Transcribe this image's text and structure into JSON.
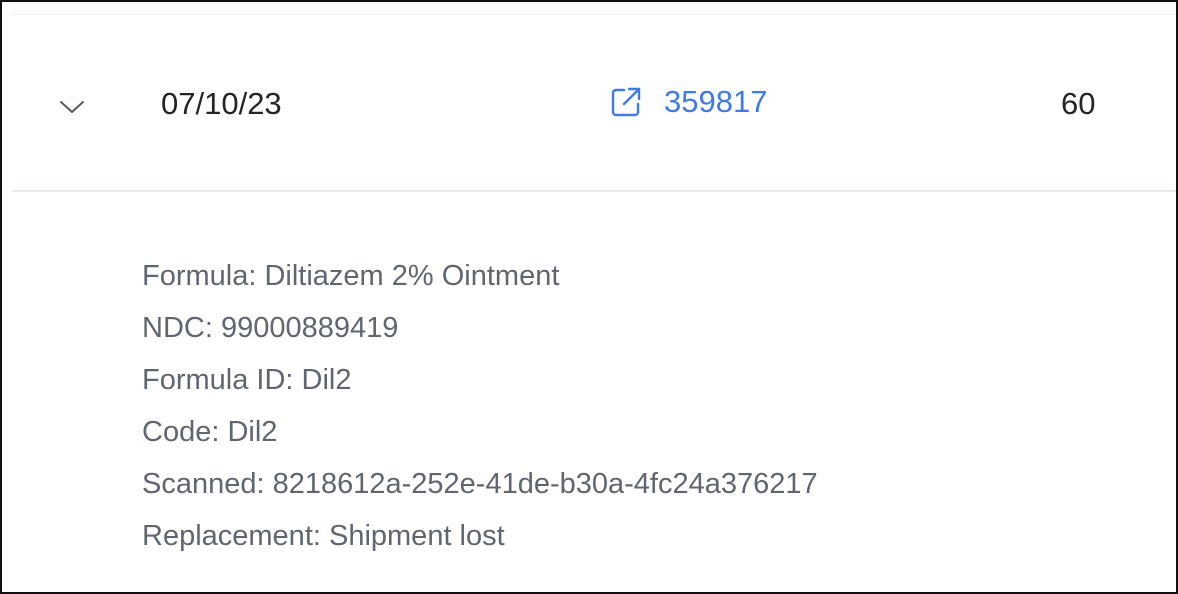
{
  "row": {
    "date": "07/10/23",
    "order_number": "359817",
    "quantity": "60",
    "expand_icon": "chevron-down-icon",
    "link_icon": "external-link-icon"
  },
  "details": {
    "formula": "Formula: Diltiazem 2% Ointment",
    "ndc": "NDC: 99000889419",
    "formula_id": "Formula ID: Dil2",
    "code": "Code: Dil2",
    "scanned": "Scanned: 8218612a-252e-41de-b30a-4fc24a376217",
    "replacement": "Replacement: Shipment lost"
  },
  "colors": {
    "link": "#3f7be6",
    "text_primary": "#222428",
    "text_secondary": "#5f6672",
    "divider": "#e7eaee"
  }
}
